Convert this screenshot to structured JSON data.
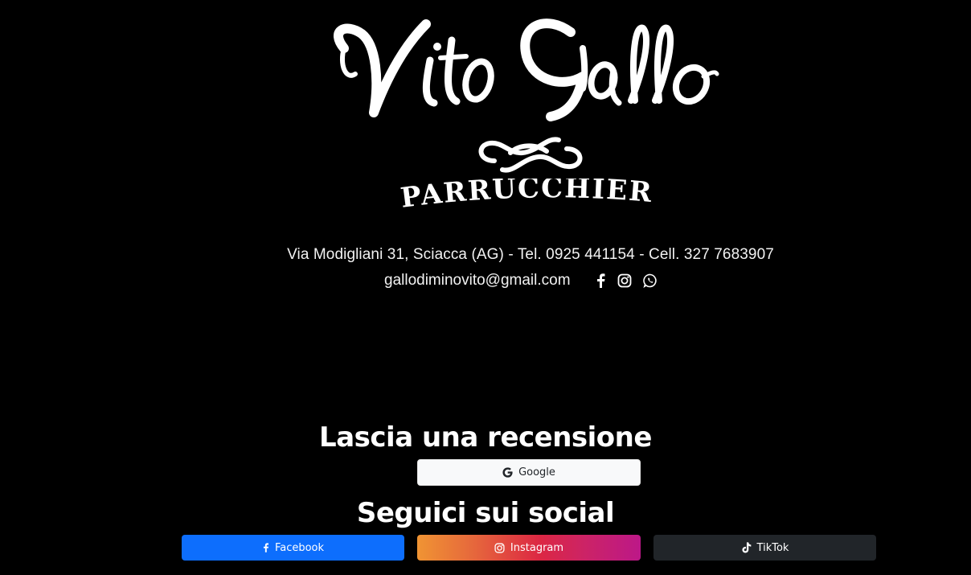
{
  "logo": {
    "script_name": "Vito Gallo",
    "subtitle": "PARRUCCHIERI",
    "contact_line": "Via Modigliani 31, Sciacca (AG) - Tel. 0925 441154 - Cell. 327 7683907",
    "email": "gallodiminovito@gmail.com",
    "icons": [
      "facebook-icon",
      "instagram-icon",
      "whatsapp-icon"
    ]
  },
  "review": {
    "heading": "Lascia una recensione",
    "google_label": "Google",
    "google_icon": "google-icon"
  },
  "social": {
    "heading": "Seguici sui social",
    "facebook_label": "Facebook",
    "instagram_label": "Instagram",
    "tiktok_label": "TikTok"
  },
  "colors": {
    "background": "#000000",
    "facebook": "#0d6efd",
    "instagram_gradient": [
      "#f09433",
      "#bc1888"
    ],
    "tiktok": "#212529",
    "google_bg": "#f8f9fa"
  }
}
